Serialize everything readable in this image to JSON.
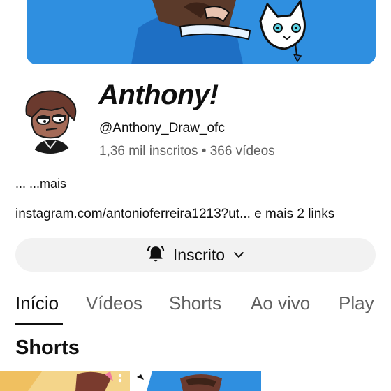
{
  "channel": {
    "name": "Anthony!",
    "handle": "@Anthony_Draw_ofc",
    "stats": "1,36 mil inscritos • 366 vídeos"
  },
  "description": {
    "text": "... ...mais",
    "links": "instagram.com/antonioferreira1213?ut... e mais 2 links"
  },
  "subscribe": {
    "label": "Inscrito",
    "icon": "bell-icon"
  },
  "tabs": [
    {
      "label": "Início",
      "active": true
    },
    {
      "label": "Vídeos",
      "active": false
    },
    {
      "label": "Shorts",
      "active": false
    },
    {
      "label": "Ao vivo",
      "active": false
    },
    {
      "label": "Play",
      "active": false
    }
  ],
  "section": {
    "title": "Shorts"
  },
  "colors": {
    "banner": "#2f8fe0",
    "tab_active": "#0f0f0f",
    "tab_inactive": "#606060",
    "button_bg": "#f2f2f2"
  }
}
